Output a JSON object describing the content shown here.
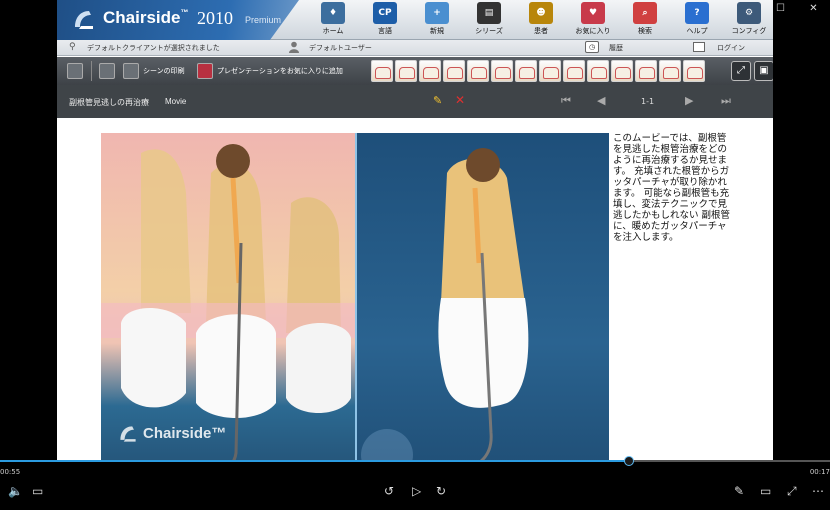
{
  "window": {
    "controls": [
      "…",
      "▣",
      "—",
      "☐",
      "✕"
    ]
  },
  "brand": {
    "name": "Chairside",
    "tm": "™",
    "year": "2010",
    "edition": "Premium"
  },
  "nav": [
    {
      "label": "ホーム",
      "icon": "chair-icon",
      "color": "#3c6e9e",
      "glyph": "♦"
    },
    {
      "label": "言語",
      "icon": "language-icon",
      "color": "#1d5ea8",
      "glyph": "CP"
    },
    {
      "label": "新規",
      "icon": "new-icon",
      "color": "#4a8fd0",
      "glyph": "+"
    },
    {
      "label": "シリーズ",
      "icon": "series-icon",
      "color": "#333333",
      "glyph": "▤"
    },
    {
      "label": "患者",
      "icon": "patient-icon",
      "color": "#b8860b",
      "glyph": "☻"
    },
    {
      "label": "お気に入り",
      "icon": "favorites-icon",
      "color": "#c83a4a",
      "glyph": "♥"
    },
    {
      "label": "検索",
      "icon": "search-icon",
      "color": "#d04040",
      "glyph": "⌕"
    },
    {
      "label": "ヘルプ",
      "icon": "help-icon",
      "color": "#2a6fd0",
      "glyph": "?"
    },
    {
      "label": "コンフィグ",
      "icon": "config-icon",
      "color": "#3d5a7a",
      "glyph": "⚙"
    }
  ],
  "infobar": {
    "client": "デフォルトクライアントが選択されました",
    "user": "デフォルトユーザー",
    "history": "履歴",
    "login": "ログイン"
  },
  "toolbar": {
    "print_scene": "シーンの印刷",
    "add_favorite": "プレゼンテーションをお気に入りに追加",
    "thumb_count": 14
  },
  "titlebar": {
    "title": "副根管見逃しの再治療",
    "type": "Movie",
    "page": "1-1"
  },
  "video": {
    "logo": "Chairside™"
  },
  "description": "このムービーでは、副根管を見逃した根管治療をどのように再治療するか見せます。 充填された根管からガッタパーチャが取り除かれます。 可能なら副根管も充填し、変法テクニックで見逃したかもしれない 副根管に、暖めたガッタパーチャを注入します。",
  "media": {
    "current_time": "00:55",
    "total_time": "00:17",
    "progress": 0.758
  },
  "colors": {
    "accent": "#2b9be0",
    "brand": "#2d6db2"
  }
}
